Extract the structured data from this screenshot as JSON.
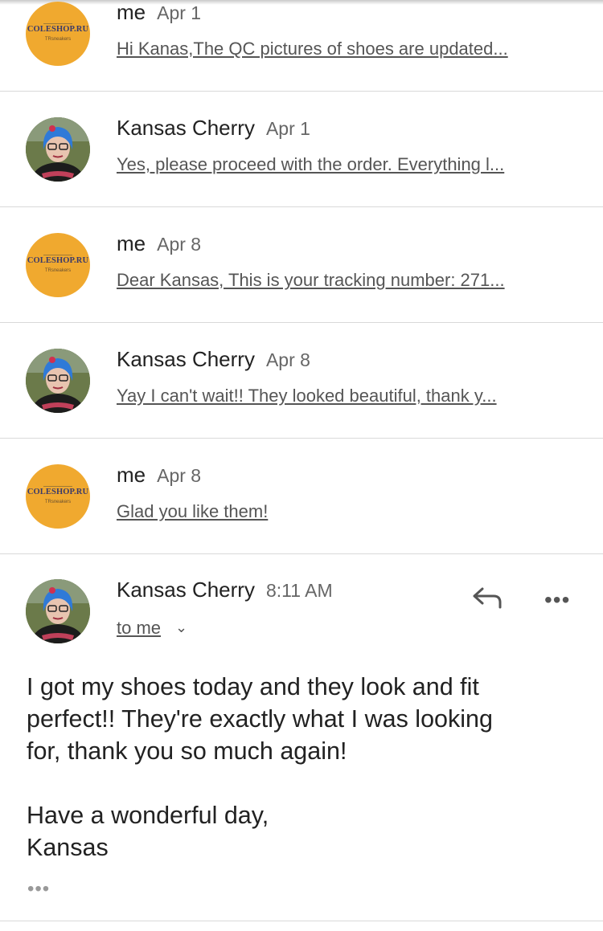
{
  "thread": [
    {
      "sender": "me",
      "date": "Apr 1",
      "snippet": "Hi Kanas,The QC pictures of shoes are updated...",
      "avatar": "coleshop-logo"
    },
    {
      "sender": "Kansas Cherry",
      "date": "Apr 1",
      "snippet": "Yes, please proceed with the order. Everything l...",
      "avatar": "kansas-photo"
    },
    {
      "sender": "me",
      "date": "Apr 8",
      "snippet": "Dear Kansas, This is your tracking number: 271...",
      "avatar": "coleshop-logo"
    },
    {
      "sender": "Kansas Cherry",
      "date": "Apr 8",
      "snippet": "Yay I can't wait!! They looked beautiful, thank y...",
      "avatar": "kansas-photo"
    },
    {
      "sender": "me",
      "date": "Apr 8",
      "snippet": "Glad you like them!",
      "avatar": "coleshop-logo"
    }
  ],
  "logo": {
    "brand": "COLESHOP.RU",
    "sub": "TRsneakers"
  },
  "open_message": {
    "sender": "Kansas Cherry",
    "time": "8:11 AM",
    "to": "to me",
    "to_chevron": "⌄",
    "more": "•••",
    "body_lines": [
      "I got my shoes today and they look and fit",
      "perfect!! They're exactly what I was looking",
      "for, thank you so much again!"
    ],
    "signoff": [
      "Have a wonderful day,",
      "Kansas"
    ],
    "trimmed": "•••"
  },
  "colors": {
    "logo_bg": "#f0a92f",
    "divider": "#d9d9d9",
    "text": "#222222",
    "muted": "#555555"
  }
}
